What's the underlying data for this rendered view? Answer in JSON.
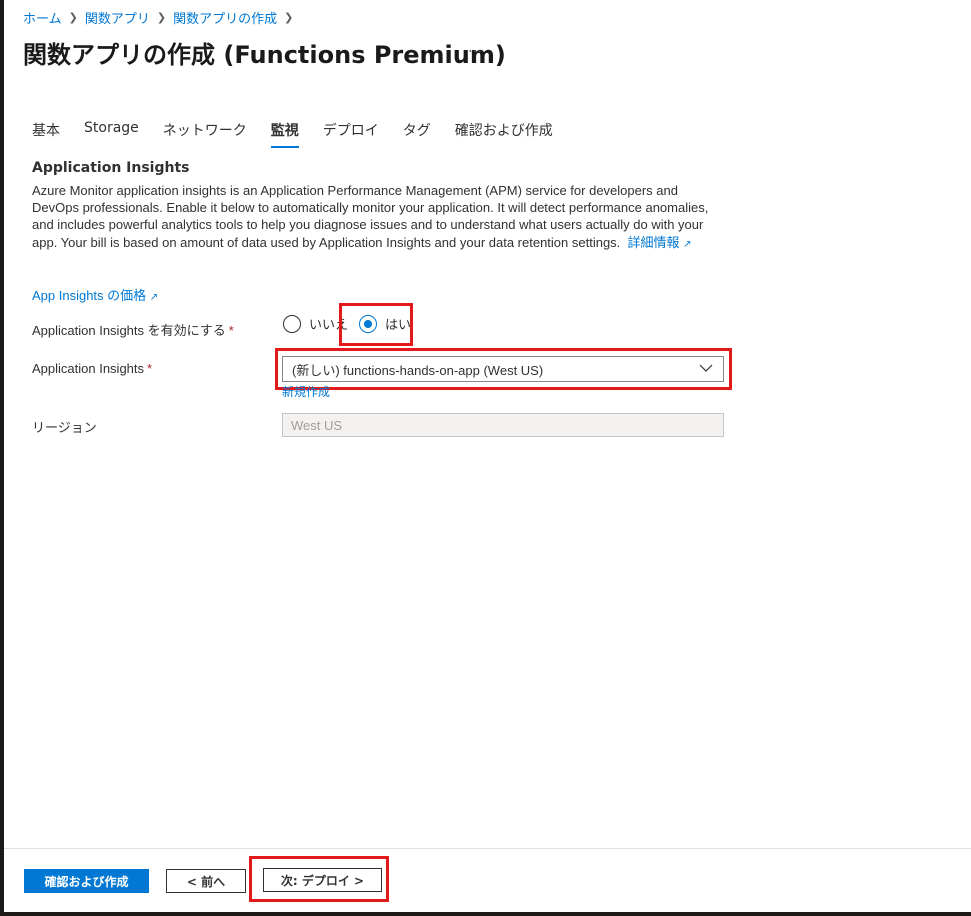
{
  "breadcrumb": {
    "items": [
      "ホーム",
      "関数アプリ",
      "関数アプリの作成"
    ]
  },
  "page": {
    "title": "関数アプリの作成 (Functions Premium)",
    "more": "…"
  },
  "tabs": [
    {
      "label": "基本",
      "active": false
    },
    {
      "label": "Storage",
      "active": false
    },
    {
      "label": "ネットワーク",
      "active": false
    },
    {
      "label": "監視",
      "active": true
    },
    {
      "label": "デプロイ",
      "active": false
    },
    {
      "label": "タグ",
      "active": false
    },
    {
      "label": "確認および作成",
      "active": false
    }
  ],
  "section": {
    "title": "Application Insights",
    "description": "Azure Monitor application insights is an Application Performance Management (APM) service for developers and DevOps professionals. Enable it below to automatically monitor your application. It will detect performance anomalies, and includes powerful analytics tools to help you diagnose issues and to understand what users actually do with your app. Your bill is based on amount of data used by Application Insights and your data retention settings.",
    "learn_more": "詳細情報",
    "pricing_link": "App Insights の価格"
  },
  "form": {
    "enable_label": "Application Insights を有効にする",
    "enable_options": {
      "no": "いいえ",
      "yes": "はい"
    },
    "enable_selected": "はい",
    "insights_label": "Application Insights",
    "insights_value": "(新しい) functions-hands-on-app (West US)",
    "new_link": "新規作成",
    "region_label": "リージョン",
    "region_value": "West US",
    "required_mark": "*"
  },
  "footer": {
    "review_create": "確認および作成",
    "previous": "< 前へ",
    "next": "次: デプロイ >"
  },
  "colors": {
    "accent": "#0078d4",
    "highlight": "#e3191b",
    "required": "#a4262c"
  }
}
